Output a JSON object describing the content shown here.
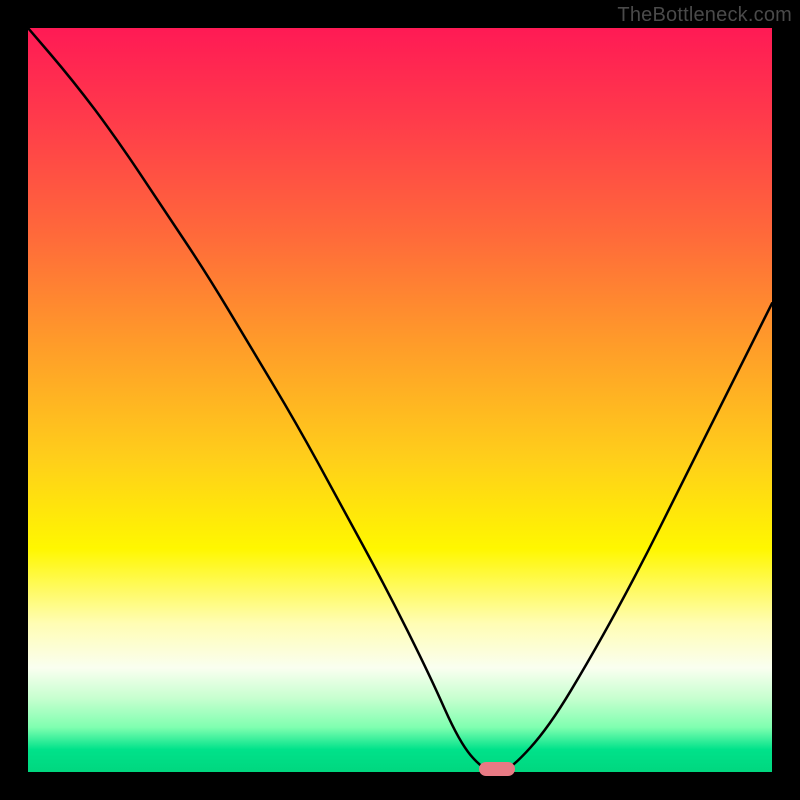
{
  "watermark": "TheBottleneck.com",
  "colors": {
    "background": "#000000",
    "gradient_top": "#ff1a55",
    "gradient_mid": "#fff700",
    "gradient_bottom": "#00d77f",
    "curve": "#000000",
    "marker": "#e87a84"
  },
  "chart_data": {
    "type": "line",
    "title": "",
    "xlabel": "",
    "ylabel": "",
    "xlim": [
      0,
      100
    ],
    "ylim": [
      0,
      100
    ],
    "x": [
      0,
      6,
      12,
      18,
      24,
      30,
      36,
      42,
      48,
      54,
      58,
      61,
      63,
      65,
      70,
      76,
      82,
      88,
      94,
      100
    ],
    "values": [
      100,
      93,
      85,
      76,
      67,
      57,
      47,
      36,
      25,
      13,
      4,
      0.5,
      0,
      0.5,
      6,
      16,
      27,
      39,
      51,
      63
    ],
    "marker": {
      "x": 63,
      "y": 0
    },
    "annotations": []
  }
}
